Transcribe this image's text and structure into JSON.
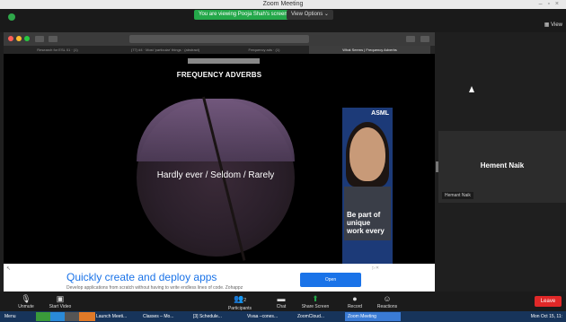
{
  "window": {
    "title": "Zoom Meeting",
    "controls": "– ▫ ×"
  },
  "zoom": {
    "viewing_banner": "You are viewing Pooja Shah's screen",
    "view_options": "View Options ⌄",
    "view_button": "View"
  },
  "browser": {
    "url": "",
    "tabs": [
      {
        "label": "Research for ESL 01 · (1)"
      },
      {
        "label": "(77) #4 · Most 'particular' things · (abstract)"
      },
      {
        "label": "Frequency ads · (1)"
      },
      {
        "label": "What Seems | Frequency Adverbs"
      },
      {
        "label": ""
      }
    ]
  },
  "slide": {
    "title": "FREQUENCY ADVERBS",
    "center_text": "Hardly ever / Seldom / Rarely"
  },
  "ad_side": {
    "brand": "ASML",
    "text": "Be part of unique work every"
  },
  "ad_footer": {
    "headline": "Quickly create and deploy apps",
    "subtext": "Develop applications from scratch without having to write endless lines of code. Zohappz",
    "button_label": "Open"
  },
  "participant": {
    "name": "Hement Naik",
    "name_tag": "Hemant Naik"
  },
  "controls": {
    "unmute": "Unmute",
    "start_video": "Start Video",
    "participants": "Participants",
    "participants_count": "2",
    "chat": "Chat",
    "share_screen": "Share Screen",
    "record": "Record",
    "reactions": "Reactions",
    "leave": "Leave"
  },
  "taskbar": {
    "items": [
      "Menu",
      "",
      "",
      "",
      "Launch Meeti...",
      "Classes – Mo...",
      "[3] Schedule...",
      "Vivaa –cones...",
      "ZoomCloud...",
      "Zoom Meeting"
    ],
    "clock": "Mon Oct 15, 11:"
  },
  "colors": {
    "zoom_green": "#24a84a",
    "leave_red": "#e02828",
    "ad_blue": "#1a73e8"
  }
}
